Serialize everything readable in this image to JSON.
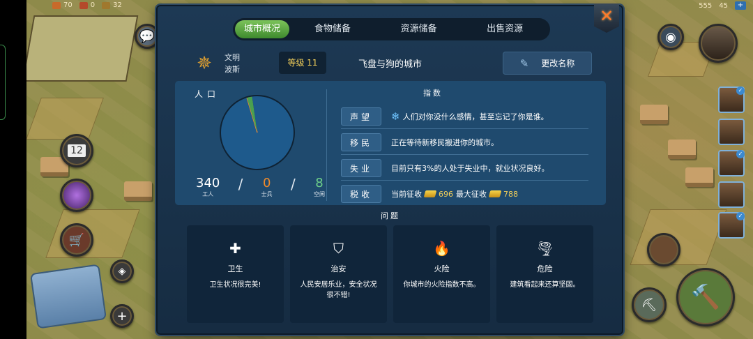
{
  "resources_left": [
    {
      "value": "70",
      "color": "#c86a2a"
    },
    {
      "value": "0",
      "color": "#b44a2a"
    },
    {
      "value": "32",
      "color": "#a0782e"
    }
  ],
  "resources_right": [
    {
      "value": "555",
      "color": "#e8c030"
    },
    {
      "value": "45",
      "color": "#2ecf9a"
    }
  ],
  "side": {
    "calendar_day": "12"
  },
  "panel": {
    "close_icon": "close-icon",
    "tabs": [
      "城市概况",
      "食物储备",
      "资源储备",
      "出售资源"
    ],
    "civ": {
      "line1": "文明",
      "line2": "波斯"
    },
    "level": "等级 11",
    "city_name": "飞盘与狗的城市",
    "rename_label": "更改名称",
    "population": {
      "title": "人口",
      "workers": "340",
      "workers_label": "工人",
      "soldiers": "0",
      "soldiers_label": "士兵",
      "idle": "8",
      "idle_label": "空闲",
      "slash": "/"
    },
    "index": {
      "title": "指数",
      "rows": [
        {
          "label": "声望",
          "text": "人们对你没什么感情，甚至忘记了你是谁。"
        },
        {
          "label": "移民",
          "text": "正在等待新移民搬进你的城市。"
        },
        {
          "label": "失业",
          "text": "目前只有3%的人处于失业中，就业状况良好。"
        },
        {
          "label": "税收",
          "current_label": "当前征收",
          "current": "696",
          "max_label": "最大征收",
          "max": "788"
        }
      ]
    },
    "issues": {
      "title": "问题",
      "cards": [
        {
          "icon": "plus-icon",
          "glyph": "✚",
          "title": "卫生",
          "desc": "卫生状况很完美!"
        },
        {
          "icon": "shield-icon",
          "glyph": "⛉",
          "title": "治安",
          "desc": "人民安居乐业，安全状况很不错!"
        },
        {
          "icon": "fire-icon",
          "glyph": "🔥",
          "title": "火险",
          "desc": "你城市的火险指数不高。"
        },
        {
          "icon": "tornado-icon",
          "glyph": "🌪",
          "title": "危险",
          "desc": "建筑看起来还算坚固。"
        }
      ]
    }
  },
  "pie_data": {
    "type": "pie",
    "slices": [
      {
        "label": "工人",
        "value": 340,
        "color": "#1e5a8c"
      },
      {
        "label": "士兵",
        "value": 0,
        "color": "#e8823a"
      },
      {
        "label": "空闲",
        "value": 8,
        "color": "#4aa050"
      }
    ]
  },
  "colors": {
    "accent_green": "#5aa843",
    "gold": "#f2cf5a",
    "panel": "#1d3954"
  }
}
